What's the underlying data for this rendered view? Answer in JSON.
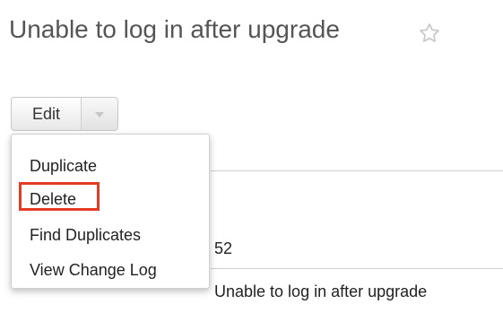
{
  "record": {
    "title": "Unable to log in after upgrade",
    "favorite_icon": "star-outline-icon"
  },
  "toolbar": {
    "edit_label": "Edit",
    "dropdown_icon": "chevron-down-icon"
  },
  "dropdown": {
    "items": [
      {
        "label": "Duplicate"
      },
      {
        "label": "Delete"
      },
      {
        "label": "Find Duplicates"
      },
      {
        "label": "View Change Log"
      }
    ]
  },
  "fields": {
    "number_value": "52",
    "subject_value": "Unable to log in after upgrade"
  },
  "colors": {
    "highlight": "#e53a24",
    "title": "#555555",
    "divider": "#cfcfcf"
  }
}
